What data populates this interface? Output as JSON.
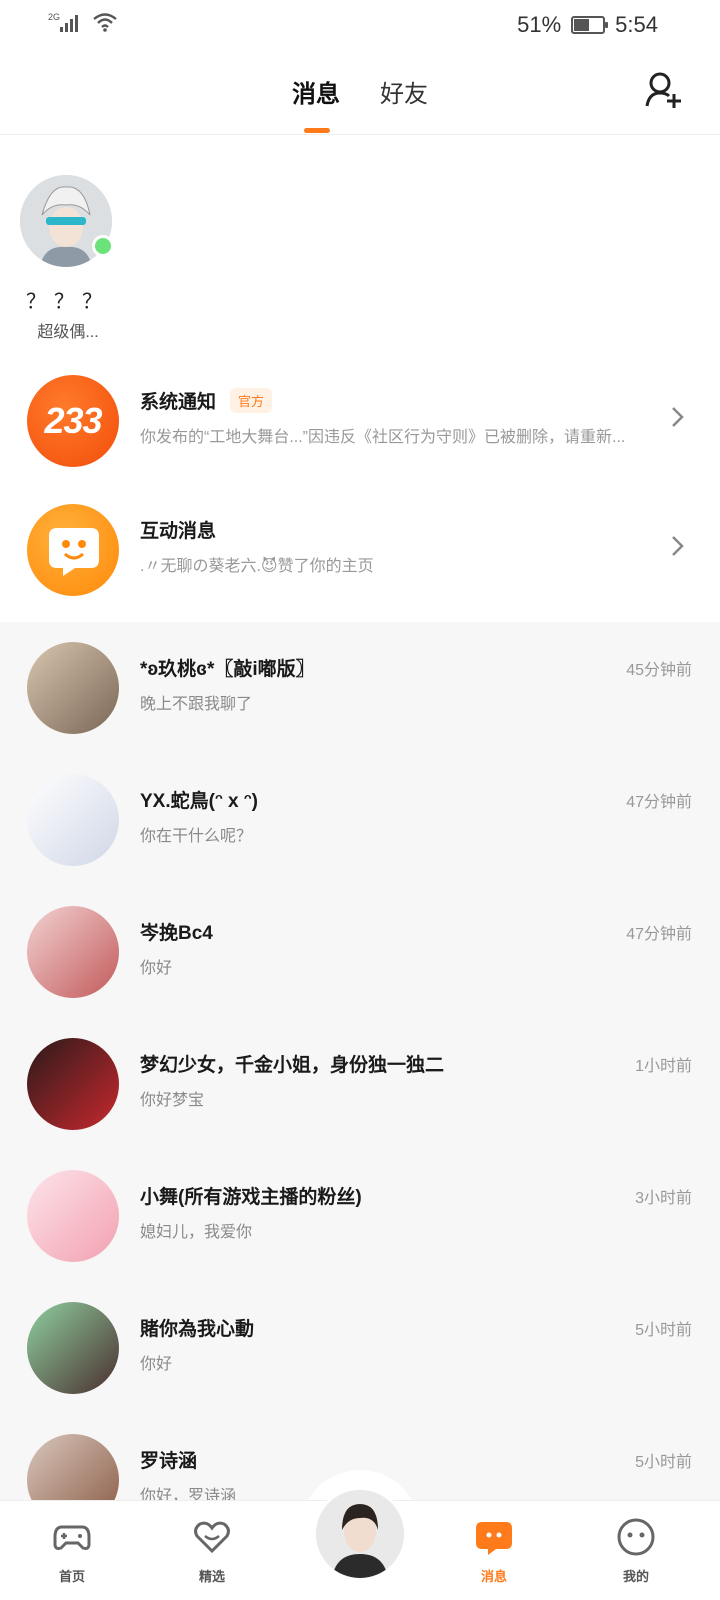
{
  "status_bar": {
    "network": "2G",
    "battery": "51%",
    "time": "5:54"
  },
  "header": {
    "tabs": [
      {
        "label": "消息",
        "active": true
      },
      {
        "label": "好友",
        "active": false
      }
    ],
    "add_friend_icon": "add-user-icon"
  },
  "online_friend": {
    "name": "？？？",
    "status": "超级偶..."
  },
  "system_rows": [
    {
      "title": "系统通知",
      "badge": "官方",
      "subtitle": "你发布的“工地大舞台...”因违反《社区行为守则》已被删除，请重新...",
      "icon_text": "233"
    },
    {
      "title": "互动消息",
      "subtitle": ".〃无聊の葵老六.😈赞了你的主页"
    }
  ],
  "chats": [
    {
      "name": "*ʚ玖桃ɞ*〖敲i嘟版〗",
      "message": "晚上不跟我聊了",
      "time": "45分钟前"
    },
    {
      "name": "YX.蛇鳥(ᵔ x ᵔ)",
      "message": "你在干什么呢？",
      "time": "47分钟前"
    },
    {
      "name": "岑挽Bc4",
      "message": "你好",
      "time": "47分钟前"
    },
    {
      "name": "梦幻少女，千金小姐，身份独一独二",
      "message": "你好梦宝",
      "time": "1小时前"
    },
    {
      "name": "小舞(所有游戏主播的粉丝)",
      "message": "媳妇儿，我爱你",
      "time": "3小时前"
    },
    {
      "name": "賭你為我心動",
      "message": "你好",
      "time": "5小时前"
    },
    {
      "name": "罗诗涵",
      "message": "你好，罗诗涵",
      "time": "5小时前"
    }
  ],
  "bottom_nav": [
    {
      "label": "首页",
      "icon": "gamepad-icon"
    },
    {
      "label": "精选",
      "icon": "heart-chat-icon"
    },
    {
      "label": "消息",
      "icon": "message-icon",
      "active": true
    },
    {
      "label": "我的",
      "icon": "face-icon"
    }
  ],
  "colors": {
    "accent": "#ff7a1a",
    "online": "#6ce37a"
  }
}
